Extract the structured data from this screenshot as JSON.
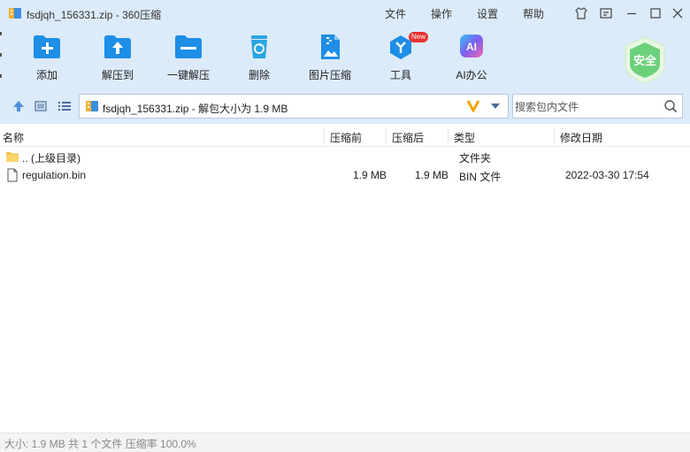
{
  "window": {
    "title": "fsdjqh_156331.zip - 360压缩",
    "menu": [
      "文件",
      "操作",
      "设置",
      "帮助"
    ],
    "controls": [
      "skin-icon",
      "message-icon",
      "minimize-icon",
      "maximize-icon",
      "close-icon"
    ]
  },
  "toolbar": {
    "items": [
      {
        "label": "添加",
        "icon": "add-icon"
      },
      {
        "label": "解压到",
        "icon": "extract-to-icon"
      },
      {
        "label": "一键解压",
        "icon": "one-click-extract-icon"
      },
      {
        "label": "删除",
        "icon": "delete-icon"
      },
      {
        "label": "图片压缩",
        "icon": "image-compress-icon"
      },
      {
        "label": "工具",
        "icon": "tools-icon",
        "badge": "New"
      },
      {
        "label": "AI办公",
        "icon": "ai-office-icon",
        "icon_text": "AI"
      }
    ],
    "security_badge": "安全"
  },
  "addressbar": {
    "path": "fsdjqh_156331.zip - 解包大小为 1.9 MB",
    "search_placeholder": "搜索包内文件"
  },
  "file_list": {
    "columns": [
      "名称",
      "压缩前",
      "压缩后",
      "类型",
      "修改日期"
    ],
    "rows": [
      {
        "name": ".. (上级目录)",
        "original": "",
        "compressed": "",
        "type": "文件夹",
        "modified": "",
        "icon": "folder-icon"
      },
      {
        "name": "regulation.bin",
        "original": "1.9 MB",
        "compressed": "1.9 MB",
        "type": "BIN 文件",
        "modified": "2022-03-30 17:54",
        "icon": "file-icon"
      }
    ]
  },
  "status": {
    "text": "大小: 1.9 MB 共 1 个文件 压缩率 100.0%"
  },
  "colors": {
    "chrome_bg": "#dcebfa",
    "accent_blue": "#1e8ee6",
    "delete_blue": "#2aa5e0",
    "ai_gradient": "#7b5cf0",
    "new_badge": "#e5312f",
    "shield_green": "#6cd17b",
    "v_orange": "#f0a300"
  }
}
